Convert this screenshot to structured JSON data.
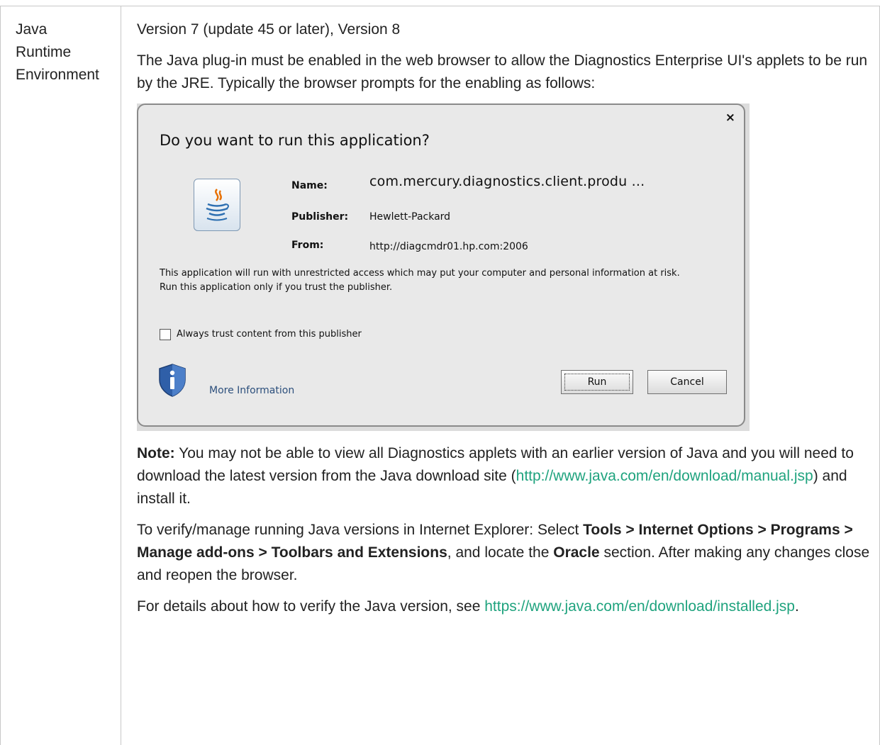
{
  "row_label": [
    "Java",
    "Runtime",
    "Environment"
  ],
  "version_line": "Version 7 (update 45 or later), Version 8",
  "plugin_text": "The Java plug-in must be enabled in the web browser to allow the Diagnostics Enterprise UI's applets to be run by the JRE. Typically the browser prompts for the enabling as follows:",
  "dialog": {
    "close_glyph": "×",
    "title": "Do you want to run this application?",
    "name_label": "Name:",
    "name_value": "com.mercury.diagnostics.client.produ ...",
    "publisher_label": "Publisher:",
    "publisher_value": "Hewlett-Packard",
    "from_label": "From:",
    "from_value": "http://diagcmdr01.hp.com:2006",
    "warning": "This application will run with unrestricted access which may put your computer and personal information at risk. Run this application only if you trust the publisher.",
    "trust_label": "Always trust content from this publisher",
    "trust_checked": false,
    "more_info": "More Information",
    "run_label": "Run",
    "cancel_label": "Cancel",
    "icons": {
      "app": "java-cup-icon",
      "info": "info-shield-icon"
    }
  },
  "note": {
    "bold": "Note:",
    "text_1": " You may not be able to view all Diagnostics applets with an earlier version of Java and you will need to download the latest version from the Java download site (",
    "link": "http://www.java.com/en/download/manual.jsp",
    "text_2": ") and install it."
  },
  "verify": {
    "text_1": "To verify/manage running Java versions in Internet Explorer: Select ",
    "path": "Tools > Internet Options > Programs > Manage add-ons > Toolbars and Extensions",
    "text_2": ", and locate the ",
    "oracle": "Oracle",
    "text_3": " section. After making any changes close and reopen the browser."
  },
  "details": {
    "text": "For details about how to verify the Java version, see ",
    "link": "https://www.java.com/en/download/installed.jsp",
    "end": "."
  },
  "colors": {
    "link": "#1fa37e",
    "rule": "#c8c8c8"
  }
}
